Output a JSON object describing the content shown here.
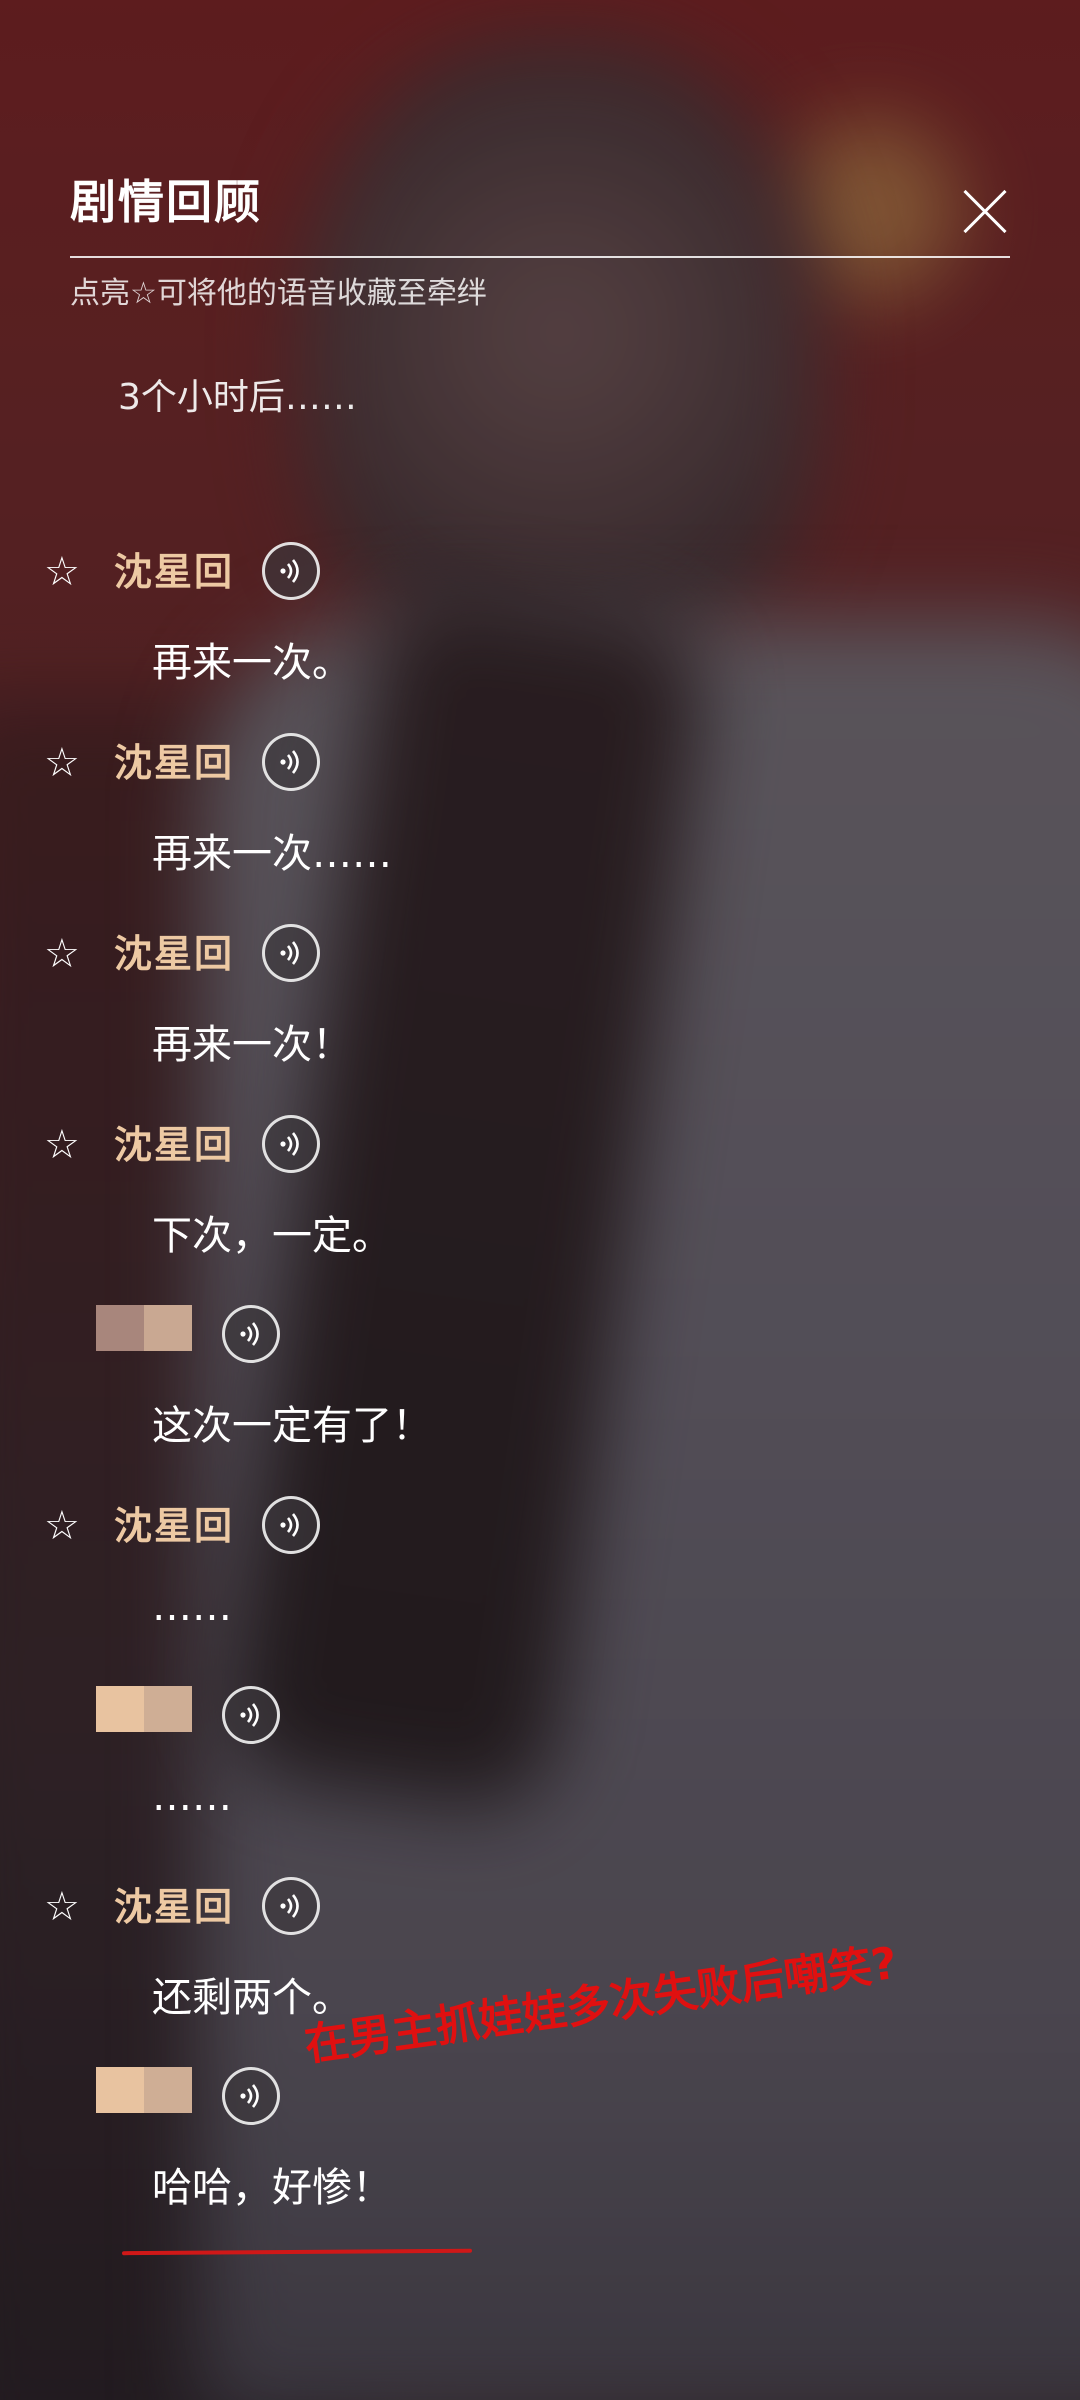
{
  "header": {
    "title": "剧情回顾",
    "subtitle": "点亮☆可将他的语音收藏至牵绊"
  },
  "narration": "3个小时后……",
  "dialogues": [
    {
      "speaker": "沈星回",
      "text": "再来一次。",
      "has_star": true
    },
    {
      "speaker": "沈星回",
      "text": "再来一次……",
      "has_star": true
    },
    {
      "speaker": "沈星回",
      "text": "再来一次！",
      "has_star": true
    },
    {
      "speaker": "沈星回",
      "text": "下次，一定。",
      "has_star": true
    },
    {
      "speaker": "",
      "text": "这次一定有了！",
      "has_star": false
    },
    {
      "speaker": "沈星回",
      "text": "……",
      "has_star": true
    },
    {
      "speaker": "",
      "text": "……",
      "has_star": false
    },
    {
      "speaker": "沈星回",
      "text": "还剩两个。",
      "has_star": true
    },
    {
      "speaker": "",
      "text": "哈哈，好惨！",
      "has_star": false
    }
  ],
  "icons": {
    "star": "star-outline-icon",
    "voice": "voice-play-icon",
    "close": "close-icon"
  },
  "colors": {
    "speaker_name": "#edc9a3",
    "annotation": "#e01010"
  },
  "annotation": {
    "text": "在男主抓娃娃多次失败后嘲笑?"
  }
}
